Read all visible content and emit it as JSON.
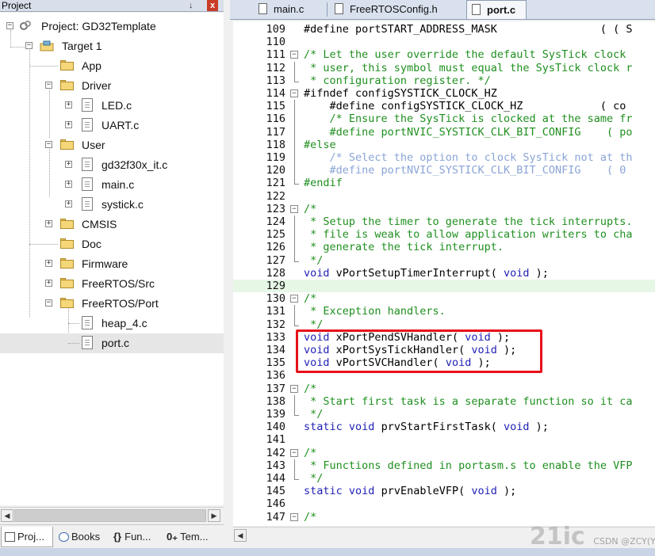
{
  "project_pane": {
    "title": "Project",
    "pin": "↓",
    "close": "x",
    "tree": [
      {
        "label": "Project: GD32Template"
      },
      {
        "label": "Target 1"
      },
      {
        "label": "App"
      },
      {
        "label": "Driver"
      },
      {
        "label": "LED.c"
      },
      {
        "label": "UART.c"
      },
      {
        "label": "User"
      },
      {
        "label": "gd32f30x_it.c"
      },
      {
        "label": "main.c"
      },
      {
        "label": "systick.c"
      },
      {
        "label": "CMSIS"
      },
      {
        "label": "Doc"
      },
      {
        "label": "Firmware"
      },
      {
        "label": "FreeRTOS/Src"
      },
      {
        "label": "FreeRTOS/Port"
      },
      {
        "label": "heap_4.c"
      },
      {
        "label": "port.c"
      }
    ],
    "bottom_tabs": [
      "Proj...",
      "Books",
      "Fun...",
      "Tem..."
    ]
  },
  "editor": {
    "tabs": [
      "main.c",
      "FreeRTOSConfig.h",
      "port.c"
    ],
    "active_tab": "port.c",
    "lines": [
      {
        "n": "109",
        "t": "#define portSTART_ADDRESS_MASK                ( ( S"
      },
      {
        "n": "110",
        "t": ""
      },
      {
        "n": "111",
        "t": "/* Let the user override the default SysTick clock"
      },
      {
        "n": "112",
        "t": " * user, this symbol must equal the SysTick clock r"
      },
      {
        "n": "113",
        "t": " * configuration register. */"
      },
      {
        "n": "114",
        "t": "#ifndef configSYSTICK_CLOCK_HZ"
      },
      {
        "n": "115",
        "t": "    #define configSYSTICK_CLOCK_HZ            ( co"
      },
      {
        "n": "116",
        "t": "    /* Ensure the SysTick is clocked at the same fr"
      },
      {
        "n": "117",
        "t": "    #define portNVIC_SYSTICK_CLK_BIT_CONFIG    ( po"
      },
      {
        "n": "118",
        "t": "#else"
      },
      {
        "n": "119",
        "t": "    /* Select the option to clock SysTick not at th"
      },
      {
        "n": "120",
        "t": "    #define portNVIC_SYSTICK_CLK_BIT_CONFIG    ( 0"
      },
      {
        "n": "121",
        "t": "#endif"
      },
      {
        "n": "122",
        "t": ""
      },
      {
        "n": "123",
        "t": "/*"
      },
      {
        "n": "124",
        "t": " * Setup the timer to generate the tick interrupts."
      },
      {
        "n": "125",
        "t": " * file is weak to allow application writers to cha"
      },
      {
        "n": "126",
        "t": " * generate the tick interrupt."
      },
      {
        "n": "127",
        "t": " */"
      },
      {
        "n": "128",
        "t": "void vPortSetupTimerInterrupt( void );"
      },
      {
        "n": "129",
        "t": ""
      },
      {
        "n": "130",
        "t": "/*"
      },
      {
        "n": "131",
        "t": " * Exception handlers."
      },
      {
        "n": "132",
        "t": " */"
      },
      {
        "n": "133",
        "t": "void xPortPendSVHandler( void );"
      },
      {
        "n": "134",
        "t": "void xPortSysTickHandler( void );"
      },
      {
        "n": "135",
        "t": "void vPortSVCHandler( void );"
      },
      {
        "n": "136",
        "t": ""
      },
      {
        "n": "137",
        "t": "/*"
      },
      {
        "n": "138",
        "t": " * Start first task is a separate function so it ca"
      },
      {
        "n": "139",
        "t": " */"
      },
      {
        "n": "140",
        "t": "static void prvStartFirstTask( void );"
      },
      {
        "n": "141",
        "t": ""
      },
      {
        "n": "142",
        "t": "/*"
      },
      {
        "n": "143",
        "t": " * Functions defined in portasm.s to enable the VFP"
      },
      {
        "n": "144",
        "t": " */"
      },
      {
        "n": "145",
        "t": "static void prvEnableVFP( void );"
      },
      {
        "n": "146",
        "t": ""
      },
      {
        "n": "147",
        "t": "/*"
      }
    ]
  },
  "watermark": {
    "text": "21ic",
    "sub": "CSDN @ZCY(Yinyuan)"
  },
  "colors": {
    "keyword": "#1f1fb5",
    "comment": "#1f8f1f",
    "highlight_box": "#e8101a"
  }
}
